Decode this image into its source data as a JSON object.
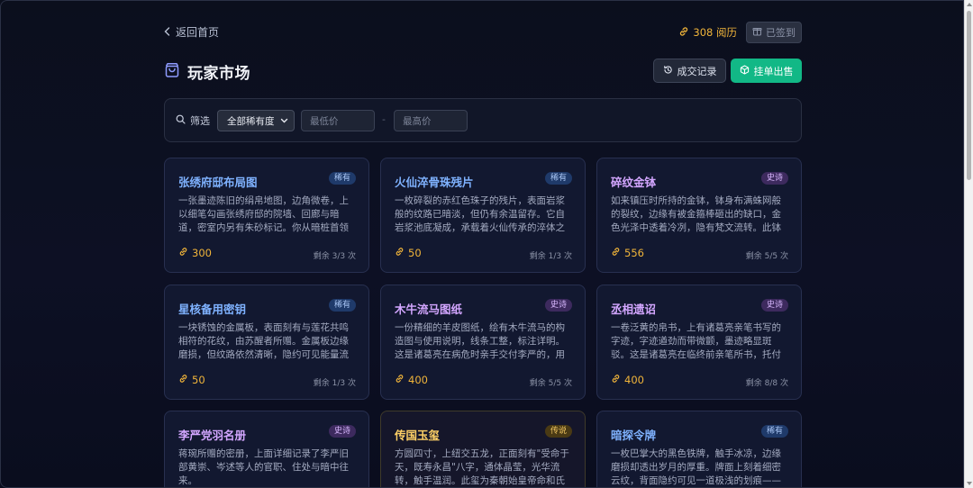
{
  "topbar": {
    "back_label": "返回首页",
    "points_label": "308 阅历",
    "signed_label": "已签到"
  },
  "header": {
    "title": "玩家市场",
    "history_label": "成交记录",
    "sell_label": "挂单出售"
  },
  "filter": {
    "label": "筛选",
    "rarity_selected": "全部稀有度",
    "min_placeholder": "最低价",
    "max_placeholder": "最高价",
    "range_sep": "-"
  },
  "colors": {
    "accent_green": "#12b886",
    "gold": "#f0b43a",
    "rare": "#7fb2ff",
    "epic": "#d3a6ff",
    "legend": "#ffd166"
  },
  "cards": [
    {
      "title": "张绣府邸布局图",
      "rarity": "稀有",
      "desc": "一张墨迹陈旧的绢帛地图，边角微卷，上以细笔勾画张绣府邸的院墙、回廊与暗道，密室内另有朱砂标记。你从暗桩首领处获得...",
      "price": "300",
      "remain": "剩余 3/3 次"
    },
    {
      "title": "火仙淬骨珠残片",
      "rarity": "稀有",
      "desc": "一枚碎裂的赤红色珠子的残片，表面岩浆般的纹路已暗淡，但仍有余温留存。它自岩浆池底凝成，承载着火仙传承的淬体之力，...",
      "price": "50",
      "remain": "剩余 1/3 次"
    },
    {
      "title": "碎纹金钵",
      "rarity": "史诗",
      "desc": "如来镇压时所持的金钵，钵身布满蛛网般的裂纹，边缘有被金箍棒砸出的缺口，金色光泽中透着冷冽，隐有梵文流转。此钵显跟...",
      "price": "556",
      "remain": "剩余 5/5 次"
    },
    {
      "title": "星核备用密钥",
      "rarity": "稀有",
      "desc": "一块锈蚀的金属板，表面刻有与莲花共鸣相符的花纹，由苏醒者所赠。金属板边缘磨损，但纹路依然清晰，隐约可见能量流转...",
      "price": "50",
      "remain": "剩余 1/3 次"
    },
    {
      "title": "木牛流马图纸",
      "rarity": "史诗",
      "desc": "一份精细的羊皮图纸，绘有木牛流马的构造图与使用说明，线条工整，标注详明。这是诸葛亮在病危时亲手交付李严的，用于在...",
      "price": "400",
      "remain": "剩余 5/5 次"
    },
    {
      "title": "丞相遗诏",
      "rarity": "史诗",
      "desc": "一卷泛黄的帛书，上有诸葛亮亲笔书写的字迹，字迹遒劲而带微颤，墨迹略显斑驳。这是诸葛亮在临终前亲笔所书，托付姜维与...",
      "price": "400",
      "remain": "剩余 8/8 次"
    },
    {
      "title": "李严党羽名册",
      "rarity": "史诗",
      "desc": "蒋琬所赠的密册，上面详细记录了李严旧部黄崇、岑述等人的官职、住处与暗中往来。",
      "price": "",
      "remain": ""
    },
    {
      "title": "传国玉玺",
      "rarity": "传说",
      "desc": "方圆四寸，上纽交五龙，正面刻有\"受命于天，既寿永昌\"八字，通体晶莹，光华流转，触手温润。此玺为秦朝始皇帝命和氏璧所...",
      "price": "",
      "remain": ""
    },
    {
      "title": "暗探令牌",
      "rarity": "稀有",
      "desc": "一枚巴掌大的黑色铁牌，触手冰凉，边缘磨损却透出岁月的厚重。牌面上刻着细密云纹，背面隐约可见一道极浅的划痕——那...",
      "price": "",
      "remain": ""
    }
  ]
}
